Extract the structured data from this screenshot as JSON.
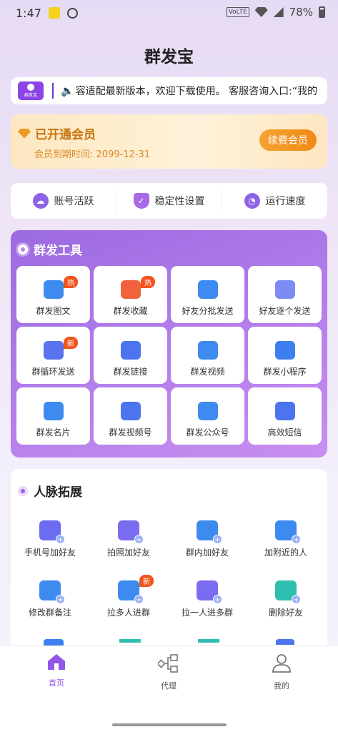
{
  "status": {
    "time": "1:47",
    "battery": "78%",
    "volte": "VoLTE"
  },
  "app_title": "群发宝",
  "notice": {
    "logo_text": "群发宝",
    "text": "容适配最新版本，欢迎下载使用。 客服咨询入口:“我的"
  },
  "vip": {
    "title": "已开通会员",
    "expiry": "会员到期时间:  2099-12-31",
    "renew_label": "续费会员"
  },
  "features": [
    {
      "label": "账号活跃",
      "icon": "account-active-icon"
    },
    {
      "label": "稳定性设置",
      "icon": "shield-check-icon"
    },
    {
      "label": "运行速度",
      "icon": "speedometer-icon"
    }
  ],
  "tools": {
    "title": "群发工具",
    "items": [
      {
        "label": "群发图文",
        "badge": "热",
        "color": "#3e8bf0",
        "icon": "chat-bubble-icon"
      },
      {
        "label": "群发收藏",
        "badge": "热",
        "color": "#f2623c",
        "icon": "star-folder-icon"
      },
      {
        "label": "好友分批发送",
        "badge": "",
        "color": "#3e8bf0",
        "icon": "batch-send-icon"
      },
      {
        "label": "好友逐个发送",
        "badge": "",
        "color": "#7d8cf2",
        "icon": "users-icon"
      },
      {
        "label": "群循环发送",
        "badge": "新",
        "color": "#5a73f0",
        "icon": "loop-send-icon"
      },
      {
        "label": "群发链接",
        "badge": "",
        "color": "#4b74ee",
        "icon": "link-icon"
      },
      {
        "label": "群发视频",
        "badge": "",
        "color": "#3e8bf0",
        "icon": "video-icon"
      },
      {
        "label": "群发小程序",
        "badge": "",
        "color": "#3e7ff0",
        "icon": "paper-plane-icon"
      },
      {
        "label": "群发名片",
        "badge": "",
        "color": "#3e8bf0",
        "icon": "card-icon"
      },
      {
        "label": "群发视频号",
        "badge": "",
        "color": "#4b74ee",
        "icon": "video-channel-icon"
      },
      {
        "label": "群发公众号",
        "badge": "",
        "color": "#3e8bf0",
        "icon": "official-account-icon"
      },
      {
        "label": "高效短信",
        "badge": "",
        "color": "#4b74ee",
        "icon": "sms-icon"
      }
    ]
  },
  "network": {
    "title": "人脉拓展",
    "items": [
      {
        "label": "手机号加好友",
        "badge": "",
        "color": "#6b6cf0",
        "icon": "phone-add-icon"
      },
      {
        "label": "拍照加好友",
        "badge": "",
        "color": "#7a6cf0",
        "icon": "camera-add-icon"
      },
      {
        "label": "群内加好友",
        "badge": "",
        "color": "#3e8bf0",
        "icon": "group-add-icon"
      },
      {
        "label": "加附近的人",
        "badge": "",
        "color": "#3e8bf0",
        "icon": "location-user-icon"
      },
      {
        "label": "修改群备注",
        "badge": "",
        "color": "#3e8bf0",
        "icon": "edit-note-icon"
      },
      {
        "label": "拉多人进群",
        "badge": "新",
        "color": "#3e8bf0",
        "icon": "invite-many-icon"
      },
      {
        "label": "拉一人进多群",
        "badge": "",
        "color": "#7a6cf0",
        "icon": "invite-one-icon"
      },
      {
        "label": "删除好友",
        "badge": "",
        "color": "#2fbfb1",
        "icon": "trash-icon"
      }
    ]
  },
  "tabs": [
    {
      "label": "首页",
      "icon": "home-icon",
      "active": true
    },
    {
      "label": "代理",
      "icon": "agent-network-icon",
      "active": false
    },
    {
      "label": "我的",
      "icon": "profile-icon",
      "active": false
    }
  ],
  "colors": {
    "primary": "#9257e4",
    "vip_text": "#c7740b",
    "badge": "#f2541d"
  }
}
